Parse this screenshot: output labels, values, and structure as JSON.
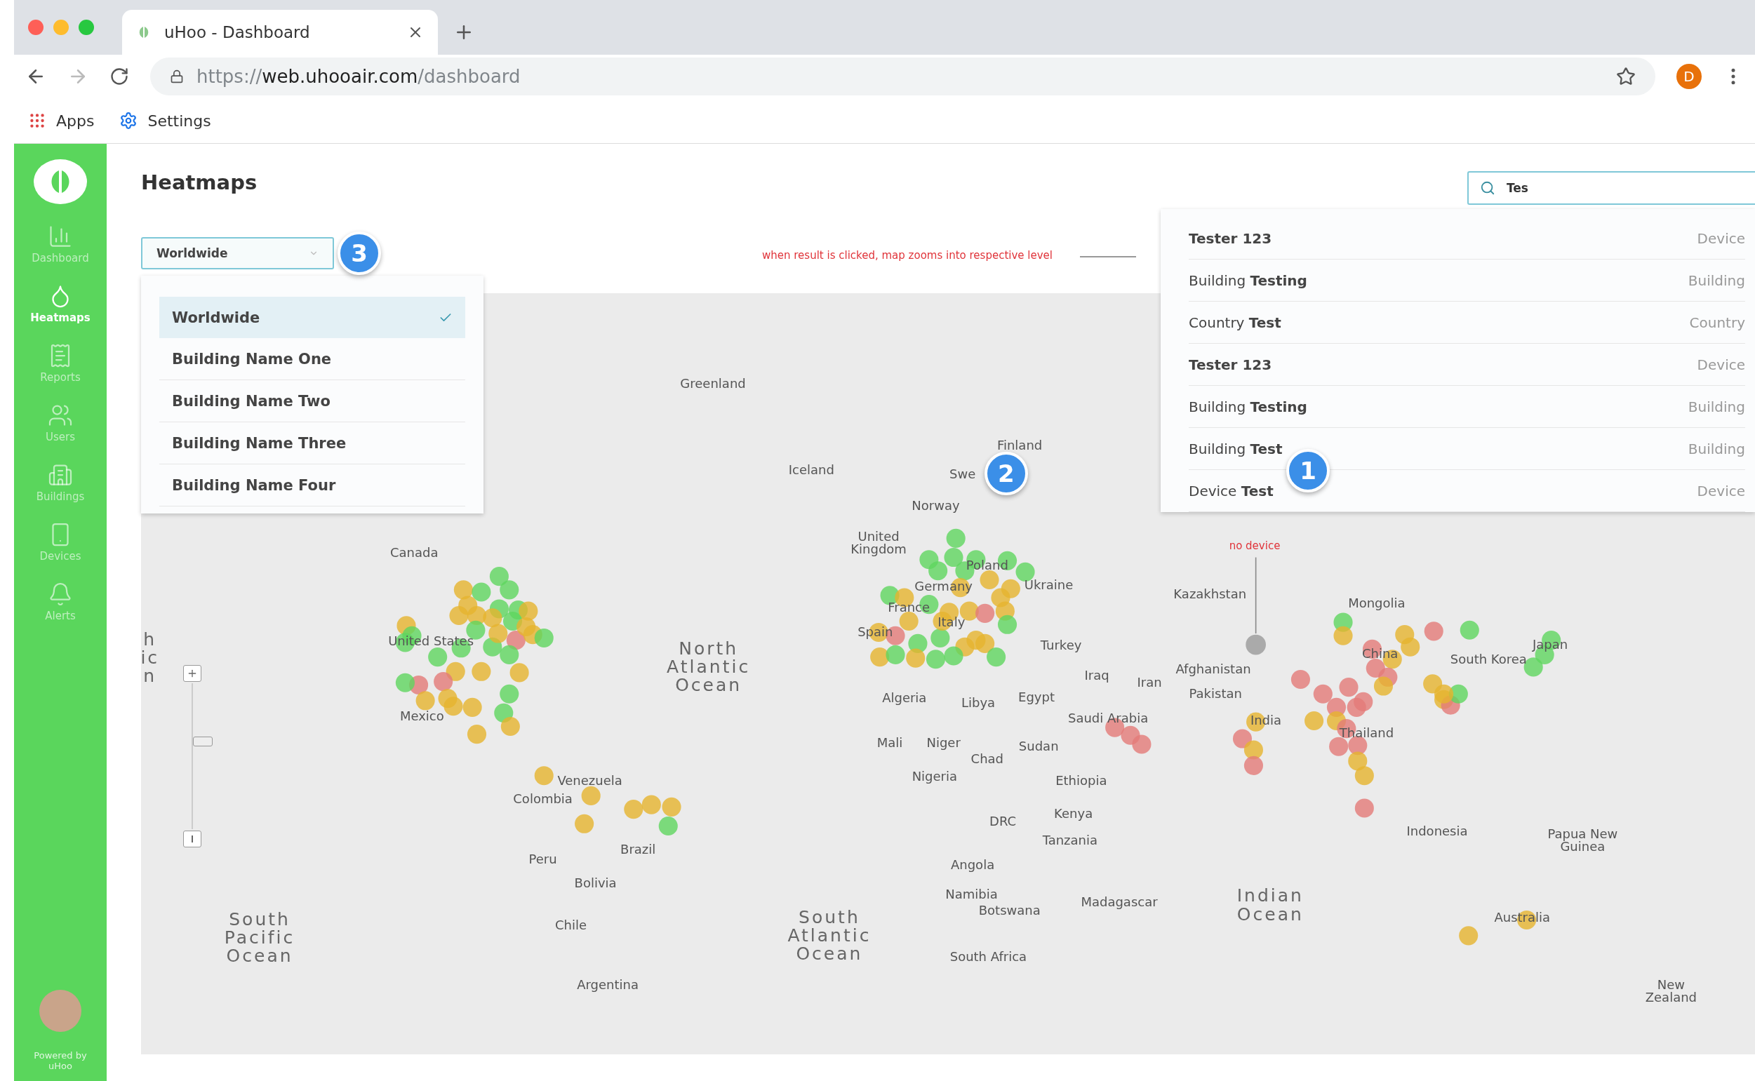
{
  "browser": {
    "tab_title": "uHoo - Dashboard",
    "url_scheme": "https://",
    "url_host": "web.uhooair.com",
    "url_path": "/dashboard",
    "profile": "D",
    "bookmarks": [
      "Apps",
      "Settings"
    ]
  },
  "sidebar": {
    "items": [
      {
        "label": "Dashboard",
        "selected": false
      },
      {
        "label": "Heatmaps",
        "selected": true
      },
      {
        "label": "Reports",
        "selected": false
      },
      {
        "label": "Users",
        "selected": false
      },
      {
        "label": "Buildings",
        "selected": false
      },
      {
        "label": "Devices",
        "selected": false
      },
      {
        "label": "Alerts",
        "selected": false
      }
    ],
    "footer": "Powered by uHoo"
  },
  "page_title": "Heatmaps",
  "location_select": {
    "value": "Worldwide",
    "badge": "3",
    "options": [
      {
        "label": "Worldwide",
        "selected": true
      },
      {
        "label": "Building Name One",
        "selected": false
      },
      {
        "label": "Building Name Two",
        "selected": false
      },
      {
        "label": "Building Name Three",
        "selected": false
      },
      {
        "label": "Building Name Four",
        "selected": false
      }
    ]
  },
  "annotation": "when result is clicked, map zooms into respective level",
  "search": {
    "value": "Tes",
    "results": [
      {
        "name": "**Tester 123**",
        "type": "Device"
      },
      {
        "name": "Building **Testing**",
        "type": "Building"
      },
      {
        "name": "Country **Test**",
        "type": "Country"
      },
      {
        "name": "**Tester 123**",
        "type": "Device"
      },
      {
        "name": "Building **Testing**",
        "type": "Building"
      },
      {
        "name": "Building **Test**",
        "type": "Building"
      },
      {
        "name": "Device **Test**",
        "type": "Device"
      }
    ],
    "badge": "1"
  },
  "map": {
    "badge": "2",
    "no_device_note": "no device",
    "zoom": {
      "level": 0.6
    },
    "labels": [
      "Greenland",
      "Iceland",
      "Finland",
      "Swe",
      "Norway",
      "United Kingdom",
      "Germany",
      "Poland",
      "Ukraine",
      "France",
      "Spain",
      "Italy",
      "Turkey",
      "Canada",
      "United States",
      "Mexico",
      "North Atlantic Ocean",
      "Algeria",
      "Libya",
      "Egypt",
      "Iraq",
      "Iran",
      "Kazakhstan",
      "Mongolia",
      "China",
      "South Korea",
      "Japan",
      "Afghanistan",
      "Pakistan",
      "India",
      "Thailand",
      "Saudi Arabia",
      "Mali",
      "Niger",
      "Sudan",
      "Chad",
      "Nigeria",
      "Ethiopia",
      "Kenya",
      "DRC",
      "Tanzania",
      "Venezuela",
      "Colombia",
      "Peru",
      "Brazil",
      "Bolivia",
      "Chile",
      "Argentina",
      "Angola",
      "Namibia",
      "Botswana",
      "South Africa",
      "Madagascar",
      "South Pacific Ocean",
      "South Atlantic Ocean",
      "Indian Ocean",
      "Indonesia",
      "Papua New Guinea",
      "Australia",
      "New Zealand",
      "h ic n"
    ]
  }
}
